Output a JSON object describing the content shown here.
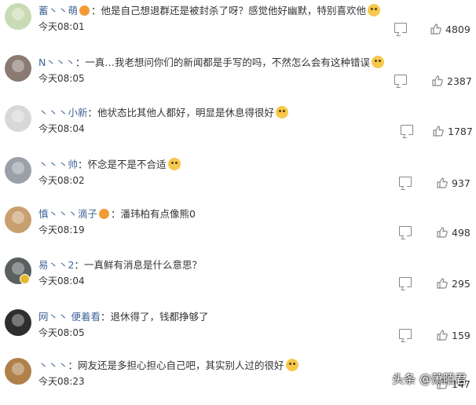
{
  "comments": [
    {
      "name": "蓄丶丶萌",
      "text": "他是自己想退群还是被封杀了呀？感觉他好幽默，特别喜欢他",
      "time": "今天08:01",
      "likes": "4809",
      "badge": true,
      "emoji": true,
      "avatar_color": "#c9dbb4"
    },
    {
      "name": "N丶丶丶",
      "text": "一真…我老想问你们的新闻都是手写的吗，不然怎么会有这种错误",
      "time": "今天08:05",
      "likes": "2387",
      "badge": false,
      "emoji": true,
      "avatar_color": "#8a7a72"
    },
    {
      "name": "丶丶丶小新",
      "text": "他状态比其他人都好，明显是休息得很好",
      "time": "今天08:04",
      "likes": "1787",
      "badge": false,
      "emoji": true,
      "avatar_color": "#d8d8d8"
    },
    {
      "name": "丶丶丶帅",
      "text": "怀念是不是不合适",
      "time": "今天08:02",
      "likes": "937",
      "badge": false,
      "emoji": true,
      "avatar_color": "#9aa0a8"
    },
    {
      "name": "慎丶丶丶滴子",
      "text": "潘玮柏有点像熊0",
      "time": "今天08:19",
      "likes": "498",
      "badge": true,
      "emoji": false,
      "avatar_color": "#c8a070"
    },
    {
      "name": "易丶丶2",
      "text": "一真鲜有消息是什么意思？",
      "time": "今天08:04",
      "likes": "295",
      "badge": false,
      "emoji": false,
      "avatar_color": "#5a6060"
    },
    {
      "name": "网丶丶 便着看",
      "text": "退休得了，钱都挣够了",
      "time": "今天08:05",
      "likes": "159",
      "badge": false,
      "emoji": false,
      "avatar_color": "#2e2e2e"
    },
    {
      "name": "丶丶丶",
      "text": "网友还是多担心担心自己吧，其实别人过的很好",
      "time": "今天08:23",
      "likes": "147",
      "badge": false,
      "emoji": true,
      "avatar_color": "#b0804a"
    }
  ],
  "separator": "：",
  "watermark": "头条 @萧陌君"
}
